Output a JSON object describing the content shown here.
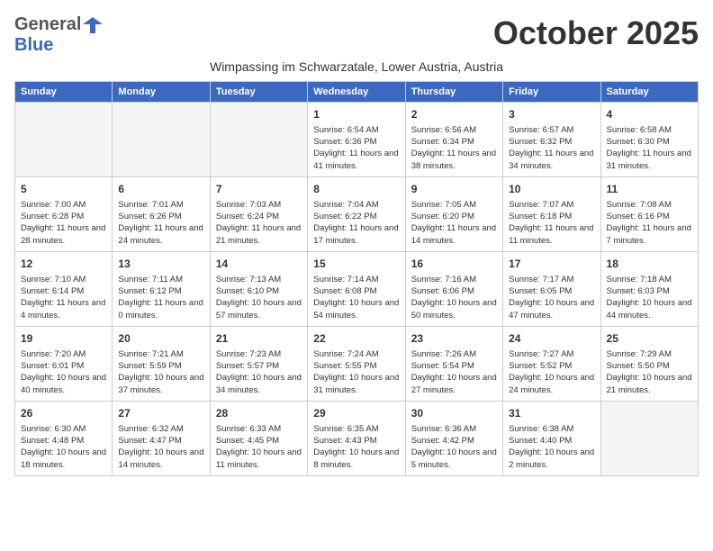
{
  "header": {
    "logo_general": "General",
    "logo_blue": "Blue",
    "month_title": "October 2025",
    "subtitle": "Wimpassing im Schwarzatale, Lower Austria, Austria"
  },
  "weekdays": [
    "Sunday",
    "Monday",
    "Tuesday",
    "Wednesday",
    "Thursday",
    "Friday",
    "Saturday"
  ],
  "weeks": [
    [
      {
        "day": null
      },
      {
        "day": null
      },
      {
        "day": null
      },
      {
        "day": "1",
        "sunrise": "Sunrise: 6:54 AM",
        "sunset": "Sunset: 6:36 PM",
        "daylight": "Daylight: 11 hours and 41 minutes."
      },
      {
        "day": "2",
        "sunrise": "Sunrise: 6:56 AM",
        "sunset": "Sunset: 6:34 PM",
        "daylight": "Daylight: 11 hours and 38 minutes."
      },
      {
        "day": "3",
        "sunrise": "Sunrise: 6:57 AM",
        "sunset": "Sunset: 6:32 PM",
        "daylight": "Daylight: 11 hours and 34 minutes."
      },
      {
        "day": "4",
        "sunrise": "Sunrise: 6:58 AM",
        "sunset": "Sunset: 6:30 PM",
        "daylight": "Daylight: 11 hours and 31 minutes."
      }
    ],
    [
      {
        "day": "5",
        "sunrise": "Sunrise: 7:00 AM",
        "sunset": "Sunset: 6:28 PM",
        "daylight": "Daylight: 11 hours and 28 minutes."
      },
      {
        "day": "6",
        "sunrise": "Sunrise: 7:01 AM",
        "sunset": "Sunset: 6:26 PM",
        "daylight": "Daylight: 11 hours and 24 minutes."
      },
      {
        "day": "7",
        "sunrise": "Sunrise: 7:03 AM",
        "sunset": "Sunset: 6:24 PM",
        "daylight": "Daylight: 11 hours and 21 minutes."
      },
      {
        "day": "8",
        "sunrise": "Sunrise: 7:04 AM",
        "sunset": "Sunset: 6:22 PM",
        "daylight": "Daylight: 11 hours and 17 minutes."
      },
      {
        "day": "9",
        "sunrise": "Sunrise: 7:05 AM",
        "sunset": "Sunset: 6:20 PM",
        "daylight": "Daylight: 11 hours and 14 minutes."
      },
      {
        "day": "10",
        "sunrise": "Sunrise: 7:07 AM",
        "sunset": "Sunset: 6:18 PM",
        "daylight": "Daylight: 11 hours and 11 minutes."
      },
      {
        "day": "11",
        "sunrise": "Sunrise: 7:08 AM",
        "sunset": "Sunset: 6:16 PM",
        "daylight": "Daylight: 11 hours and 7 minutes."
      }
    ],
    [
      {
        "day": "12",
        "sunrise": "Sunrise: 7:10 AM",
        "sunset": "Sunset: 6:14 PM",
        "daylight": "Daylight: 11 hours and 4 minutes."
      },
      {
        "day": "13",
        "sunrise": "Sunrise: 7:11 AM",
        "sunset": "Sunset: 6:12 PM",
        "daylight": "Daylight: 11 hours and 0 minutes."
      },
      {
        "day": "14",
        "sunrise": "Sunrise: 7:13 AM",
        "sunset": "Sunset: 6:10 PM",
        "daylight": "Daylight: 10 hours and 57 minutes."
      },
      {
        "day": "15",
        "sunrise": "Sunrise: 7:14 AM",
        "sunset": "Sunset: 6:08 PM",
        "daylight": "Daylight: 10 hours and 54 minutes."
      },
      {
        "day": "16",
        "sunrise": "Sunrise: 7:16 AM",
        "sunset": "Sunset: 6:06 PM",
        "daylight": "Daylight: 10 hours and 50 minutes."
      },
      {
        "day": "17",
        "sunrise": "Sunrise: 7:17 AM",
        "sunset": "Sunset: 6:05 PM",
        "daylight": "Daylight: 10 hours and 47 minutes."
      },
      {
        "day": "18",
        "sunrise": "Sunrise: 7:18 AM",
        "sunset": "Sunset: 6:03 PM",
        "daylight": "Daylight: 10 hours and 44 minutes."
      }
    ],
    [
      {
        "day": "19",
        "sunrise": "Sunrise: 7:20 AM",
        "sunset": "Sunset: 6:01 PM",
        "daylight": "Daylight: 10 hours and 40 minutes."
      },
      {
        "day": "20",
        "sunrise": "Sunrise: 7:21 AM",
        "sunset": "Sunset: 5:59 PM",
        "daylight": "Daylight: 10 hours and 37 minutes."
      },
      {
        "day": "21",
        "sunrise": "Sunrise: 7:23 AM",
        "sunset": "Sunset: 5:57 PM",
        "daylight": "Daylight: 10 hours and 34 minutes."
      },
      {
        "day": "22",
        "sunrise": "Sunrise: 7:24 AM",
        "sunset": "Sunset: 5:55 PM",
        "daylight": "Daylight: 10 hours and 31 minutes."
      },
      {
        "day": "23",
        "sunrise": "Sunrise: 7:26 AM",
        "sunset": "Sunset: 5:54 PM",
        "daylight": "Daylight: 10 hours and 27 minutes."
      },
      {
        "day": "24",
        "sunrise": "Sunrise: 7:27 AM",
        "sunset": "Sunset: 5:52 PM",
        "daylight": "Daylight: 10 hours and 24 minutes."
      },
      {
        "day": "25",
        "sunrise": "Sunrise: 7:29 AM",
        "sunset": "Sunset: 5:50 PM",
        "daylight": "Daylight: 10 hours and 21 minutes."
      }
    ],
    [
      {
        "day": "26",
        "sunrise": "Sunrise: 6:30 AM",
        "sunset": "Sunset: 4:48 PM",
        "daylight": "Daylight: 10 hours and 18 minutes."
      },
      {
        "day": "27",
        "sunrise": "Sunrise: 6:32 AM",
        "sunset": "Sunset: 4:47 PM",
        "daylight": "Daylight: 10 hours and 14 minutes."
      },
      {
        "day": "28",
        "sunrise": "Sunrise: 6:33 AM",
        "sunset": "Sunset: 4:45 PM",
        "daylight": "Daylight: 10 hours and 11 minutes."
      },
      {
        "day": "29",
        "sunrise": "Sunrise: 6:35 AM",
        "sunset": "Sunset: 4:43 PM",
        "daylight": "Daylight: 10 hours and 8 minutes."
      },
      {
        "day": "30",
        "sunrise": "Sunrise: 6:36 AM",
        "sunset": "Sunset: 4:42 PM",
        "daylight": "Daylight: 10 hours and 5 minutes."
      },
      {
        "day": "31",
        "sunrise": "Sunrise: 6:38 AM",
        "sunset": "Sunset: 4:40 PM",
        "daylight": "Daylight: 10 hours and 2 minutes."
      },
      {
        "day": null
      }
    ]
  ]
}
